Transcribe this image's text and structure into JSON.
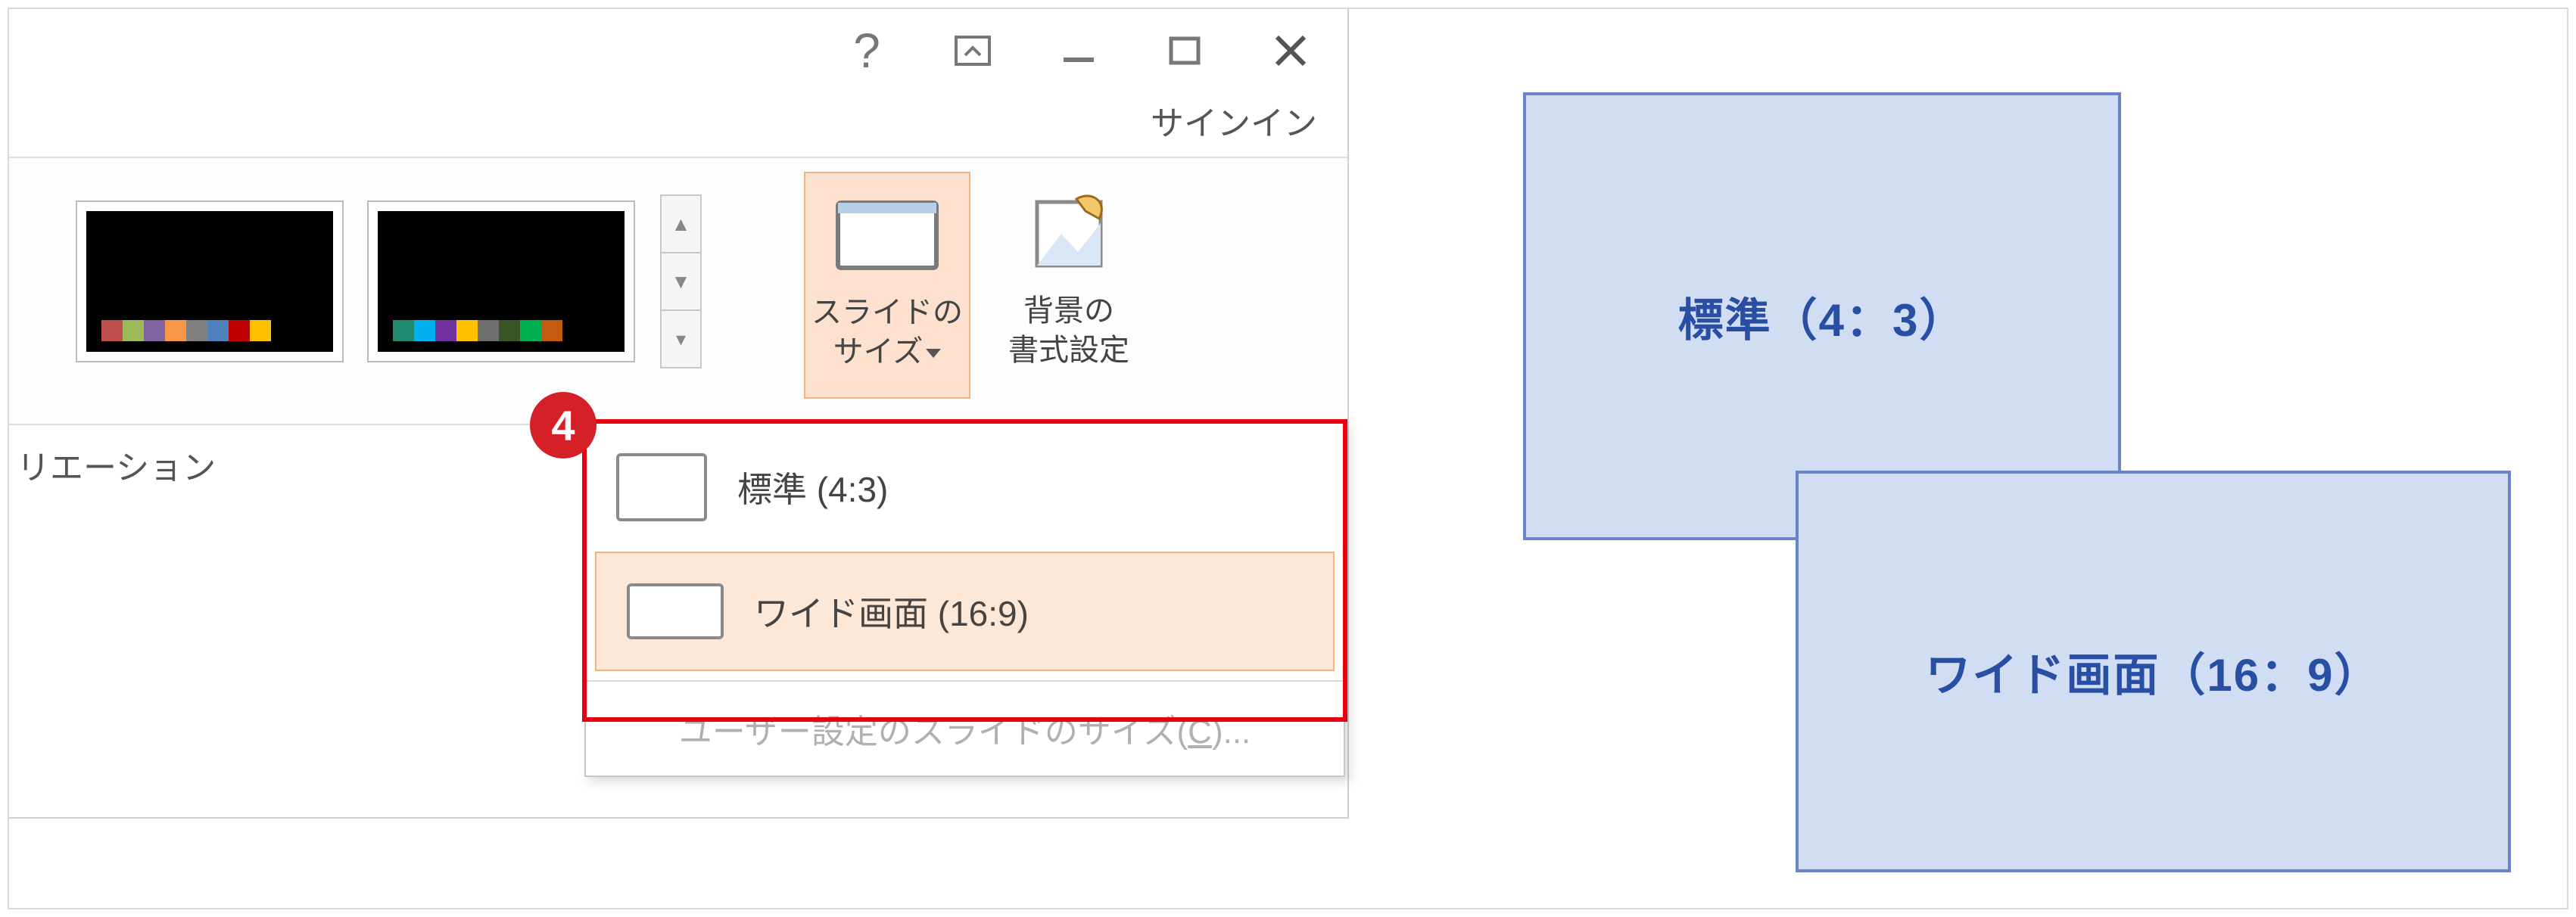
{
  "window": {
    "signin_label": "サインイン"
  },
  "ribbon": {
    "variants_group_label": "リエーション",
    "slide_size_label_line1": "スライドの",
    "slide_size_label_line2": "サイズ",
    "background_label_line1": "背景の",
    "background_label_line2": "書式設定"
  },
  "variant_palettes": [
    [
      "#c0504d",
      "#9bbb59",
      "#8064a2",
      "#f79646",
      "#808080",
      "#4f81bd",
      "#c00000",
      "#ffc000"
    ],
    [
      "#1f8a70",
      "#00b0f0",
      "#7030a0",
      "#ffc000",
      "#6e6e6e",
      "#375623",
      "#00b050",
      "#c55a11"
    ]
  ],
  "callouts": {
    "marker_4": "4"
  },
  "dropdown": {
    "items": [
      {
        "label": "標準 (4:3)",
        "selected": false
      },
      {
        "label": "ワイド画面 (16:9)",
        "selected": true
      }
    ],
    "footer_prefix": "ユーザー設定のスライドのサイズ(",
    "footer_key": "C",
    "footer_suffix": ")..."
  },
  "diagram": {
    "standard_label": "標準（4：3）",
    "wide_label": "ワイド画面（16：9）"
  }
}
